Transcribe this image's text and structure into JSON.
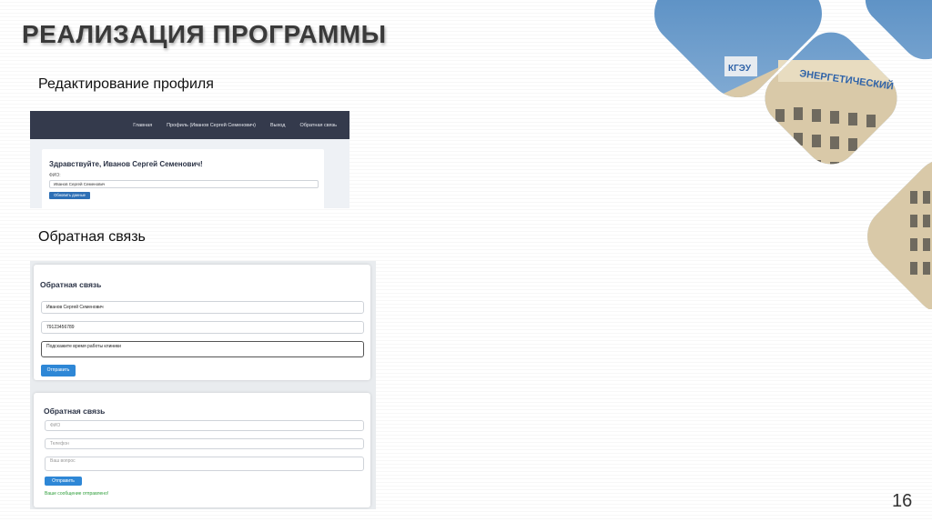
{
  "slide": {
    "title": "РЕАЛИЗАЦИЯ ПРОГРАММЫ",
    "section_profile": "Редактирование профиля",
    "section_feedback": "Обратная связь",
    "page_number": "16"
  },
  "profile_shot": {
    "nav_items": [
      "Главная",
      "Профиль (Иванов Сергей Семенович)",
      "Выход",
      "Обратная связь"
    ],
    "greeting": "Здравствуйте, Иванов Сергей Семенович!",
    "field_label": "ФИО:",
    "field_value": "Иванов Сергей Семенович",
    "button_label": "Обновить данные"
  },
  "feedback_filled": {
    "title": "Обратная связь",
    "name_value": "Иванов Сергей Семенович",
    "phone_value": "79123456789",
    "question_value": "Подскажите время работы клиники",
    "button_label": "Отправить"
  },
  "feedback_sent": {
    "title": "Обратная связь",
    "name_placeholder": "ФИО",
    "phone_placeholder": "Телефон",
    "question_placeholder": "Ваш вопрос",
    "button_label": "Отправить",
    "success_message": "Ваше сообщение отправлено!"
  },
  "photo": {
    "building_sign": "ЭНЕРГЕТИЧЕСКИЙ",
    "logo_text": "КГЭУ"
  },
  "colors": {
    "nav_bg": "#343a4c",
    "primary_button": "#2e87d6",
    "success_text": "#2e9e3a",
    "title_text": "#3a3a3a"
  }
}
